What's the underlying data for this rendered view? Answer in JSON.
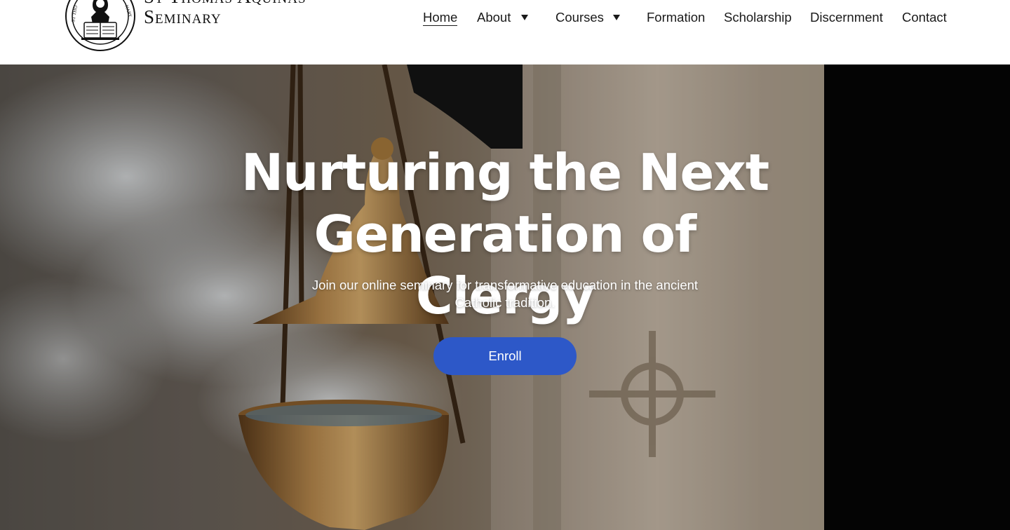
{
  "logo": {
    "line1": "St Thomas Aquinas",
    "line2": "Seminary",
    "seal_ring_text": "ST THOMAS AQUINAS SEMINARY",
    "book_text": "Dans Hoss ut Asti Corp ruori ends"
  },
  "nav": {
    "items": [
      {
        "label": "Home",
        "active": true,
        "dropdown": false
      },
      {
        "label": "About",
        "active": false,
        "dropdown": true
      },
      {
        "label": "Courses",
        "active": false,
        "dropdown": true
      },
      {
        "label": "Formation",
        "active": false,
        "dropdown": false
      },
      {
        "label": "Scholarship",
        "active": false,
        "dropdown": false
      },
      {
        "label": "Discernment",
        "active": false,
        "dropdown": false
      },
      {
        "label": "Contact",
        "active": false,
        "dropdown": false
      }
    ],
    "dropdown_icon": "caret-down-icon"
  },
  "hero": {
    "title_line1": "Nurturing the Next",
    "title_line2": "Generation of Clergy",
    "subtitle": "Join our online seminary for transformative education in the ancient Catholic tradition.",
    "cta_label": "Enroll",
    "background_description_icon": "censer-incense-image"
  },
  "colors": {
    "accent": "#2d58c8",
    "text_dark": "#1a1a1a",
    "header_bg": "#ffffff",
    "hero_text": "#ffffff"
  }
}
